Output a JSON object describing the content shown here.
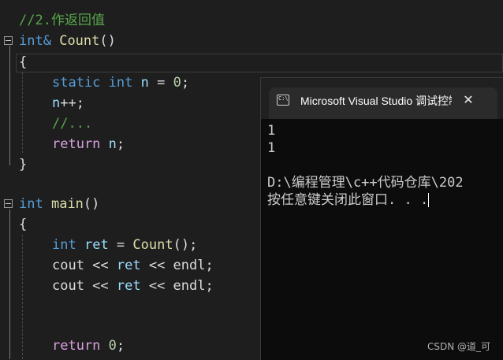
{
  "editor": {
    "lines": {
      "comment": "//2.作返回值",
      "sig_type": "int&",
      "sig_fn": "Count",
      "sig_paren": "()",
      "open_brace": "{",
      "static_kw": "static",
      "static_type": "int",
      "static_var": "n",
      "static_rest": " = ",
      "static_num": "0",
      "static_semi": ";",
      "inc_var": "n",
      "inc_rest": "++;",
      "dots": "//...",
      "ret_kw": "return",
      "ret_var": "n",
      "ret_semi": ";",
      "close_brace": "}",
      "main_type": "int",
      "main_fn": "main",
      "main_paren": "()",
      "main_open": "{",
      "decl_type": "int",
      "decl_var": "ret",
      "decl_eq": " = ",
      "decl_fn": "Count",
      "decl_end": "();",
      "cout1_a": "cout << ",
      "cout1_var": "ret",
      "cout1_b": " << endl;",
      "cout2_a": "cout << ",
      "cout2_var": "ret",
      "cout2_b": " << endl;",
      "ret0_kw": "return",
      "ret0_num": "0",
      "ret0_semi": ";"
    }
  },
  "console": {
    "title": "Microsoft Visual Studio 调试控制台",
    "icon_label": "C:\\",
    "close_glyph": "✕",
    "output": [
      "1",
      "1",
      "",
      "D:\\编程管理\\c++代码仓库\\202",
      "按任意键关闭此窗口. . ."
    ]
  },
  "watermark": "CSDN @道_可",
  "colors": {
    "background": "#1e1e1e",
    "console_bg": "#0c0c0c",
    "keyword": "#569cd6",
    "function": "#dcdcaa",
    "variable": "#9cdcfe",
    "comment": "#57a64a",
    "control": "#d8a0df"
  }
}
